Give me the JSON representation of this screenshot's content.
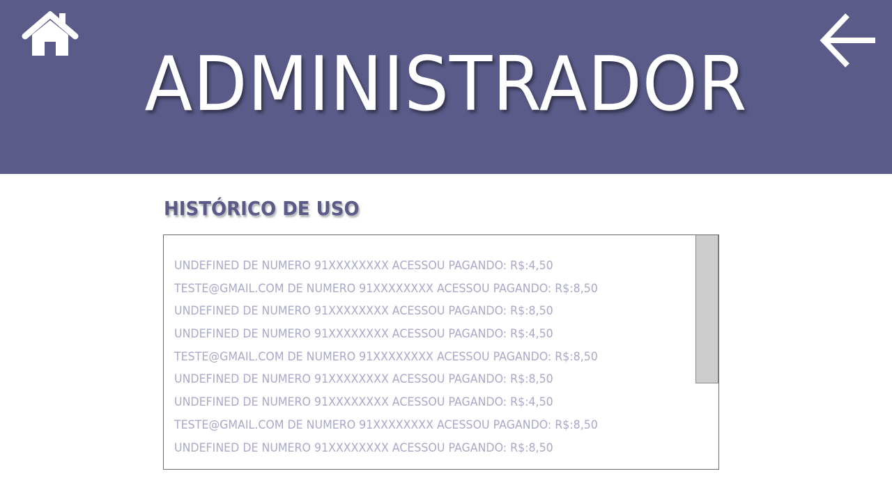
{
  "header": {
    "title": "ADMINISTRADOR",
    "background_color": "#5a5b89",
    "home_icon": "home-icon",
    "back_icon": "arrow-left-icon"
  },
  "history": {
    "title": "HISTÓRICO DE USO",
    "text_color": "#a9a9c8",
    "entries": [
      "UNDEFINED DE NUMERO 91XXXXXXXX ACESSOU PAGANDO: R$:4,50",
      "TESTE@GMAIL.COM DE NUMERO 91XXXXXXXX ACESSOU PAGANDO: R$:8,50",
      "UNDEFINED DE NUMERO 91XXXXXXXX ACESSOU PAGANDO: R$:8,50",
      "UNDEFINED DE NUMERO 91XXXXXXXX ACESSOU PAGANDO: R$:4,50",
      "TESTE@GMAIL.COM DE NUMERO 91XXXXXXXX ACESSOU PAGANDO: R$:8,50",
      "UNDEFINED DE NUMERO 91XXXXXXXX ACESSOU PAGANDO: R$:8,50",
      "UNDEFINED DE NUMERO 91XXXXXXXX ACESSOU PAGANDO: R$:4,50",
      "TESTE@GMAIL.COM DE NUMERO 91XXXXXXXX ACESSOU PAGANDO: R$:8,50",
      "UNDEFINED DE NUMERO 91XXXXXXXX ACESSOU PAGANDO: R$:8,50"
    ]
  }
}
